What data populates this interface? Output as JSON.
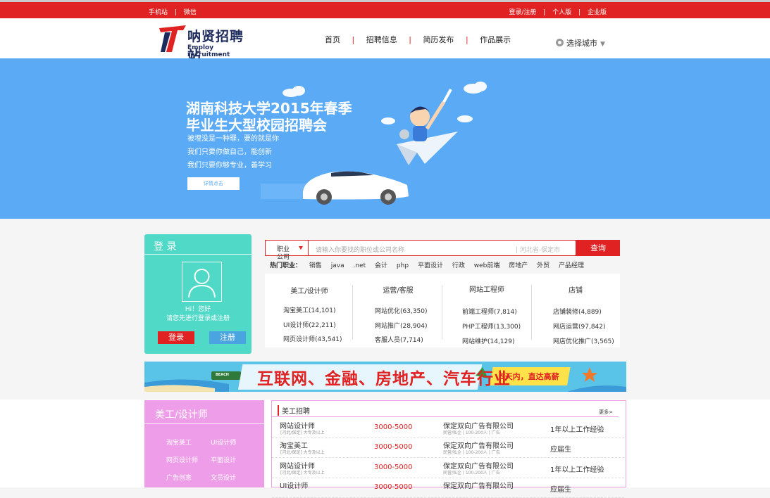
{
  "topbar": {
    "left": [
      "手机站",
      "微信"
    ],
    "right": [
      "登录/注册",
      "个人版",
      "企业版"
    ]
  },
  "header": {
    "logo_zh": "呐贤招聘站",
    "logo_en": "Employ recruitment",
    "nav": [
      "首页",
      "招聘信息",
      "简历发布",
      "作品展示"
    ],
    "city": "选择城市"
  },
  "banner": {
    "title1": "湖南科技大学2015年春季",
    "title2": "毕业生大型校园招聘会",
    "lines": [
      "被埋没是一种罪，要的就是你",
      "我们只要你做自己，能创新",
      "我们只要你够专业，善学习"
    ],
    "button": "详情点击"
  },
  "login": {
    "title": "登 录",
    "hi": "Hi！您好",
    "tip": "请您先进行登录或注册",
    "login_button": "登录",
    "register_button": "注册"
  },
  "search": {
    "select_label": "职业",
    "select_sub": "公司",
    "placeholder": "请输入你要找的职位或公司名称",
    "location": "| 河北省-保定市",
    "button": "查询"
  },
  "hot": {
    "label": "热门职业：",
    "keywords": [
      "销售",
      "java",
      ".net",
      "会计",
      "php",
      "平面设计",
      "行政",
      "web前端",
      "房地产",
      "外贸",
      "产品经理"
    ]
  },
  "categories": [
    {
      "title": "美工/设计师",
      "items": [
        "淘宝美工(14,101)",
        "UI设计师(22,211)",
        "网页设计师(43,541)"
      ]
    },
    {
      "title": "运营/客服",
      "items": [
        "网站优化(63,350)",
        "网站推广(28,904)",
        "客服人员(7,714)"
      ]
    },
    {
      "title": "网站工程师",
      "items": [
        "前端工程师(7,814)",
        "PHP工程师(13,300)",
        "网站维护(14,129)"
      ]
    },
    {
      "title": "店铺",
      "items": [
        "店铺装修(4,889)",
        "网店运营(97,842)",
        "网店优化推广(3,565)"
      ]
    }
  ],
  "ad": {
    "text": "互联网、金融、房地产、汽车行业",
    "sub": "5天内，直达高薪",
    "beach": "BEACH"
  },
  "section": {
    "side_title": "美工/设计师",
    "side_items": [
      "淘宝美工",
      "UI设计师",
      "网页设计师",
      "平面设计",
      "广告创意",
      "文员设计"
    ],
    "header": "美工招聘",
    "more": "更多>",
    "jobs": [
      {
        "name": "网站设计师",
        "tags": "[河北/保定] 大专及以上",
        "salary": "3000-5000",
        "company": "保定双向广告有限公司",
        "info": "民营/私企 | 100-200人 | 广告",
        "exp": "1年以上工作经验"
      },
      {
        "name": "淘宝美工",
        "tags": "[河北/保定] 大专及以上",
        "salary": "3000-5000",
        "company": "保定双向广告有限公司",
        "info": "民营/私企 | 100-200人 | 广告",
        "exp": "应届生"
      },
      {
        "name": "网站设计师",
        "tags": "[河北/保定] 大专及以上",
        "salary": "3000-5000",
        "company": "保定双向广告有限公司",
        "info": "民营/私企 | 100-200人 | 广告",
        "exp": "1年以上工作经验"
      },
      {
        "name": "UI设计师",
        "tags": "",
        "salary": "3000-5000",
        "company": "保定双向广告有限公司",
        "info": "",
        "exp": "应届生"
      }
    ]
  },
  "colors": {
    "brand_red": "#e02222",
    "banner_blue": "#5aaaf6",
    "login_teal": "#4fd9c6",
    "section_pink": "#ee9de8"
  }
}
